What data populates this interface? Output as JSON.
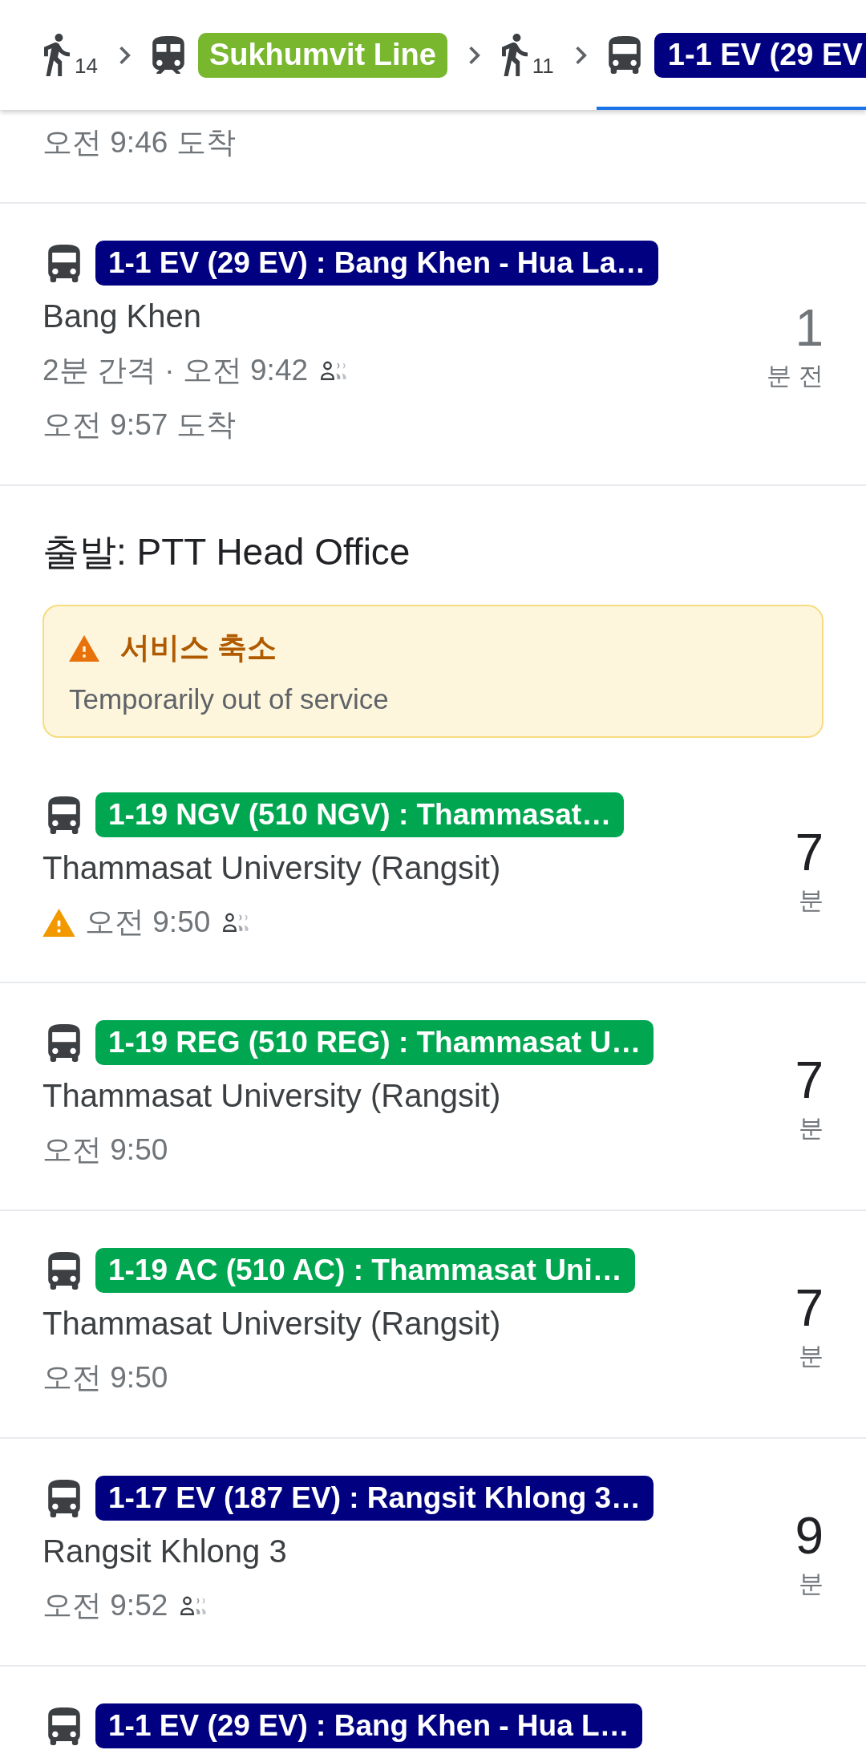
{
  "header": {
    "segments": [
      {
        "kind": "walk",
        "minutes": "14",
        "selected": false
      },
      {
        "kind": "train",
        "label": "Sukhumvit Line",
        "color": "#78b72e",
        "selected": false
      },
      {
        "kind": "walk",
        "minutes": "11",
        "selected": false
      },
      {
        "kind": "bus",
        "label": "1-1 EV (29 EV",
        "color": "#000080",
        "selected": true
      }
    ]
  },
  "list": [
    {
      "kind": "fragment",
      "arrival": "오전 9:46 도착"
    },
    {
      "kind": "departure",
      "route": "1-1 EV (29 EV) : Bang Khen - Hua La…",
      "color": "#000080",
      "stop": "Bang Khen",
      "time": "2분 간격 · 오전 9:42",
      "arrival": "오전 9:57 도착",
      "minutes": "1",
      "unit": "분 전",
      "past": true,
      "warning": false,
      "crowding_icon": true
    },
    {
      "kind": "heading",
      "text": "출발: PTT Head Office"
    },
    {
      "kind": "alert",
      "title": "서비스 축소",
      "message": "Temporarily out of service"
    },
    {
      "kind": "departure",
      "route": "1-19 NGV (510 NGV) : Thammasat…",
      "color": "#00a650",
      "stop": "Thammasat University (Rangsit)",
      "time": "오전 9:50",
      "minutes": "7",
      "unit": "분",
      "past": false,
      "warning": true,
      "crowding_icon": true
    },
    {
      "kind": "departure",
      "route": "1-19 REG (510 REG) : Thammasat U…",
      "color": "#00a650",
      "stop": "Thammasat University (Rangsit)",
      "time": "오전 9:50",
      "minutes": "7",
      "unit": "분",
      "past": false,
      "warning": false,
      "crowding_icon": false
    },
    {
      "kind": "departure",
      "route": "1-19 AC (510 AC) : Thammasat Uni…",
      "color": "#00a650",
      "stop": "Thammasat University (Rangsit)",
      "time": "오전 9:50",
      "minutes": "7",
      "unit": "분",
      "past": false,
      "warning": false,
      "crowding_icon": false
    },
    {
      "kind": "departure",
      "route": "1-17 EV (187 EV) : Rangsit Khlong 3…",
      "color": "#000080",
      "stop": "Rangsit Khlong 3",
      "time": "오전 9:52",
      "minutes": "9",
      "unit": "분",
      "past": false,
      "warning": false,
      "crowding_icon": true
    },
    {
      "kind": "departure",
      "route": "1-1 EV (29 EV) : Bang Khen - Hua L…",
      "color": "#000080"
    }
  ]
}
